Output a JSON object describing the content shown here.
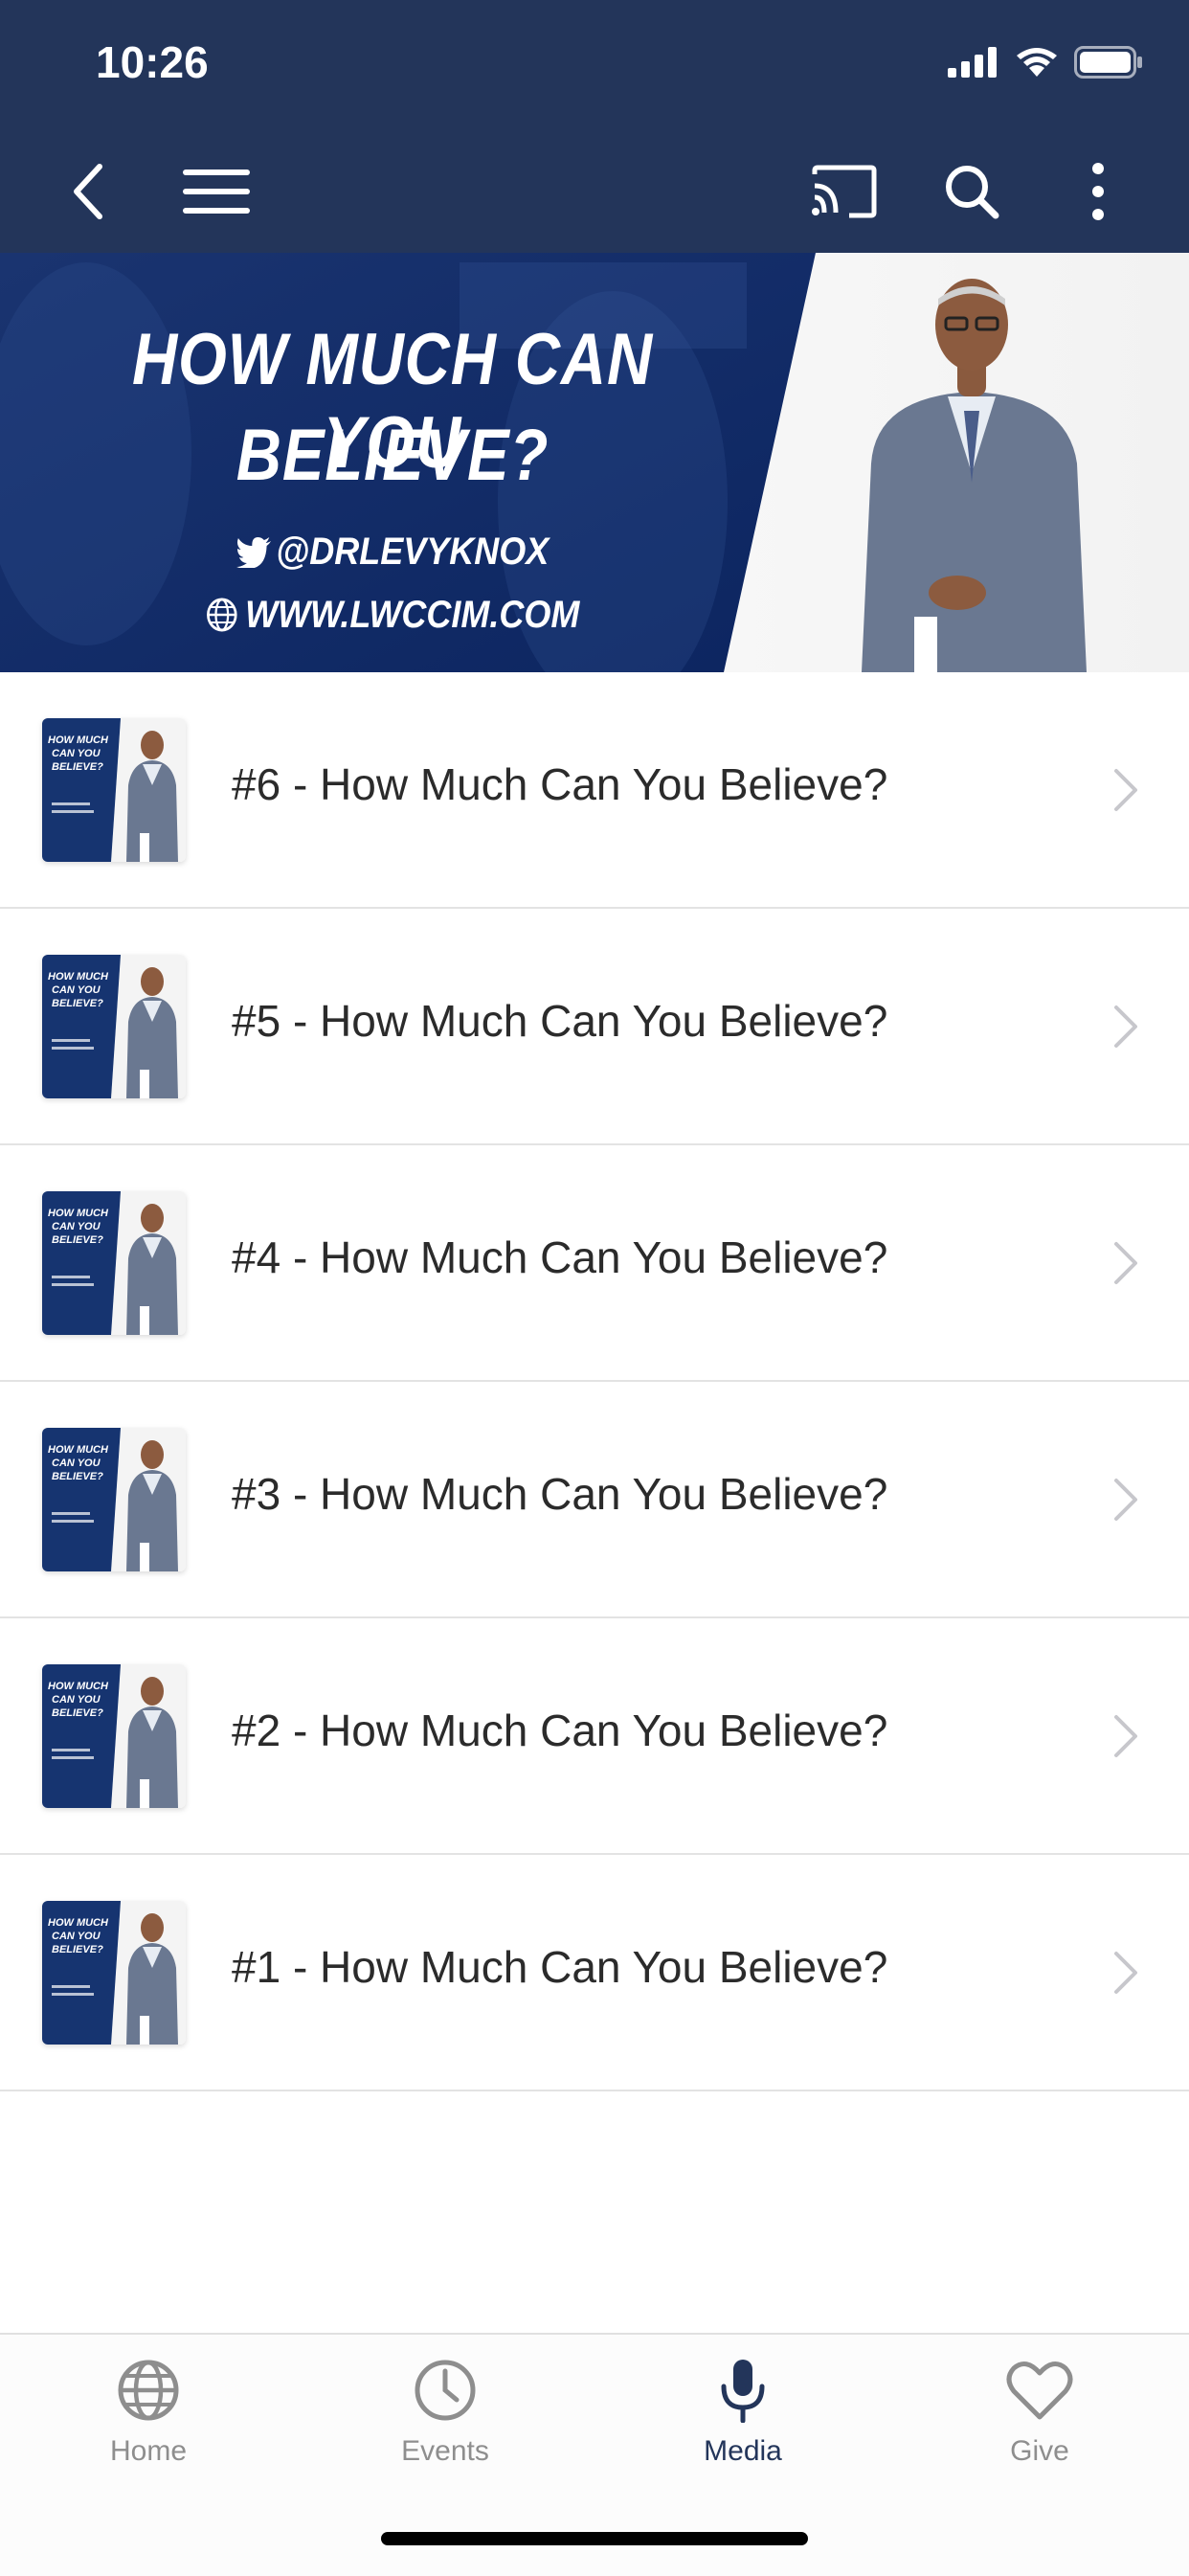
{
  "status_bar": {
    "time": "10:26"
  },
  "header": {
    "back_icon": "chevron-left-icon",
    "menu_icon": "hamburger-icon",
    "cast_icon": "cast-icon",
    "search_icon": "search-icon",
    "more_icon": "more-vertical-icon",
    "color": "#23355a"
  },
  "banner": {
    "line1": "HOW MUCH CAN YOU",
    "line2": "BELIEVE?",
    "twitter": "@DRLEVYKNOX",
    "website": "WWW.LWCCIM.COM"
  },
  "items": [
    {
      "title": "#6 - How Much Can You Believe?"
    },
    {
      "title": "#5 - How Much Can You Believe?"
    },
    {
      "title": "#4 - How Much Can You Believe?"
    },
    {
      "title": "#3 - How Much Can You Believe?"
    },
    {
      "title": "#2 - How Much Can You Believe?"
    },
    {
      "title": "#1 - How Much Can You Believe?"
    }
  ],
  "thumbnail_text": {
    "l1": "HOW MUCH",
    "l2": "CAN YOU",
    "l3": "BELIEVE?"
  },
  "tabs": [
    {
      "label": "Home",
      "icon": "globe-icon"
    },
    {
      "label": "Events",
      "icon": "clock-icon"
    },
    {
      "label": "Media",
      "icon": "microphone-icon",
      "active": true
    },
    {
      "label": "Give",
      "icon": "heart-icon"
    }
  ]
}
